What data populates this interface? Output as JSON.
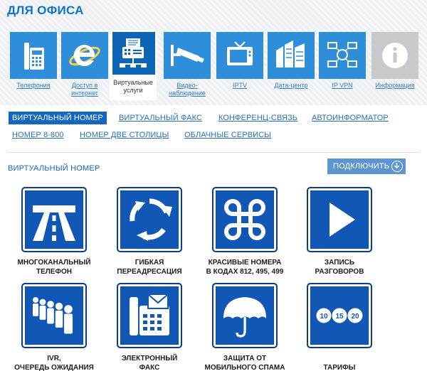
{
  "page_title": "ДЛЯ ОФИСА",
  "categories": [
    {
      "label": "Телефония",
      "icon": "fax-phone-icon"
    },
    {
      "label": "Доступ в интернет",
      "icon": "internet-explorer-icon"
    },
    {
      "label": "Виртуальные услуги",
      "icon": "network-fax-icon",
      "active": true
    },
    {
      "label": "Видео-наблюдение",
      "icon": "security-camera-icon"
    },
    {
      "label": "IPTV",
      "icon": "tv-icon"
    },
    {
      "label": "Дата-центр",
      "icon": "datacenter-icon"
    },
    {
      "label": "IP VPN",
      "icon": "vpn-network-icon"
    },
    {
      "label": "Информация",
      "icon": "info-icon"
    }
  ],
  "sub_nav": [
    {
      "label": "ВИРТУАЛЬНЫЙ НОМЕР",
      "active": true
    },
    {
      "label": "ВИРТУАЛЬНЫЙ ФАКС"
    },
    {
      "label": "КОНФЕРЕНЦ-СВЯЗЬ"
    },
    {
      "label": "АВТОИНФОРМАТОР"
    },
    {
      "label": "НОМЕР 8-800"
    },
    {
      "label": "НОМЕР ДВЕ СТОЛИЦЫ"
    },
    {
      "label": "ОБЛАЧНЫЕ СЕРВИСЫ"
    }
  ],
  "section_title": "ВИРТУАЛЬНЫЙ НОМЕР",
  "connect_label": "ПОДКЛЮЧИТЬ",
  "features": [
    {
      "line1": "МНОГОКАНАЛЬНЫЙ",
      "line2": "ТЕЛЕФОН",
      "icon": "highway-icon"
    },
    {
      "line1": "ГИБКАЯ",
      "line2": "ПЕРЕАДРЕСАЦИЯ",
      "icon": "roundabout-arrows-icon"
    },
    {
      "line1": "КРАСИВЫЕ НОМЕРА",
      "line2": "В КОДАХ  812, 495, 499",
      "icon": "command-key-icon"
    },
    {
      "line1": "ЗАПИСЬ",
      "line2": "РАЗГОВОРОВ",
      "icon": "play-icon"
    },
    {
      "line1": "IVR,",
      "line2": "ОЧЕРЕДЬ ОЖИДАНИЯ",
      "icon": "queue-people-icon"
    },
    {
      "line1": "ЭЛЕКТРОННЫЙ",
      "line2": "ФАКС",
      "icon": "fax-mail-icon"
    },
    {
      "line1": "ЗАЩИТА ОТ",
      "line2": "МОБИЛЬНОГО СПАМА",
      "icon": "umbrella-icon"
    },
    {
      "line1": "",
      "line2": "ТАРИФЫ",
      "icon": "tariffs-icon",
      "tariff_numbers": [
        "10",
        "15",
        "20"
      ]
    }
  ],
  "colors": {
    "accent": "#1466c0",
    "tile": "#2f8ed9",
    "feature_icon": "#1057b6",
    "info_tile": "#c7c9cc"
  }
}
